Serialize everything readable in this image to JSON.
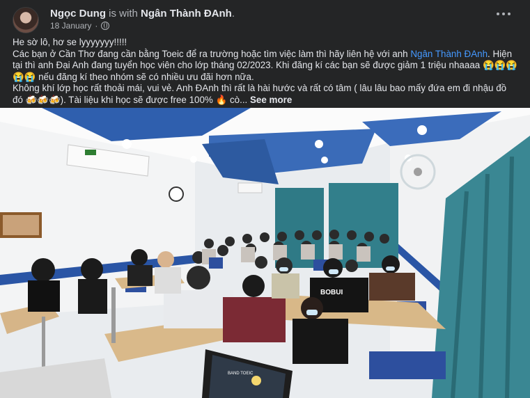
{
  "post": {
    "author": "Ngọc Dung",
    "with_text": "is with",
    "tagged": "Ngân Thành ĐAnh",
    "period": ".",
    "date": "18 January",
    "date_sep": "·",
    "privacy_icon": "globe-icon",
    "more_icon": "more-horizontal-icon",
    "caption": {
      "line1": "He sờ lô, hơ se lyyyyyyy!!!!!",
      "p2_a": "Các bạn ở Cần Thơ đang cần bằng Toeic để ra trường hoặc tìm việc làm thì hãy liên hệ với anh ",
      "p2_link": "Ngân Thành ĐAnh",
      "p2_b": ". Hiện tại thì anh Đại Anh đang tuyển học viên cho lớp tháng 02/2023. Khi đăng kí các bạn sẽ được giảm 1 triệu nhaaaa 😭😭😭😭😭 nếu đăng kí theo nhóm sẽ có nhiều ưu đãi hơn nữa.",
      "p3_a": "Không khí lớp học rất thoải mái, vui vẻ. Anh ĐAnh thì rất là hài hước và rất có tâm ( lâu lâu bao mấy đứa em đi nhậu đồ đó 🍻🍻🍻). Tài liệu khi học sẽ được free 100% 🔥 cò...",
      "see_more": "See more"
    },
    "photo": {
      "subject": "classroom-group-photo",
      "laptop_screen_text": "BAND TOEIC",
      "shirt_text": "BOBUI"
    }
  }
}
